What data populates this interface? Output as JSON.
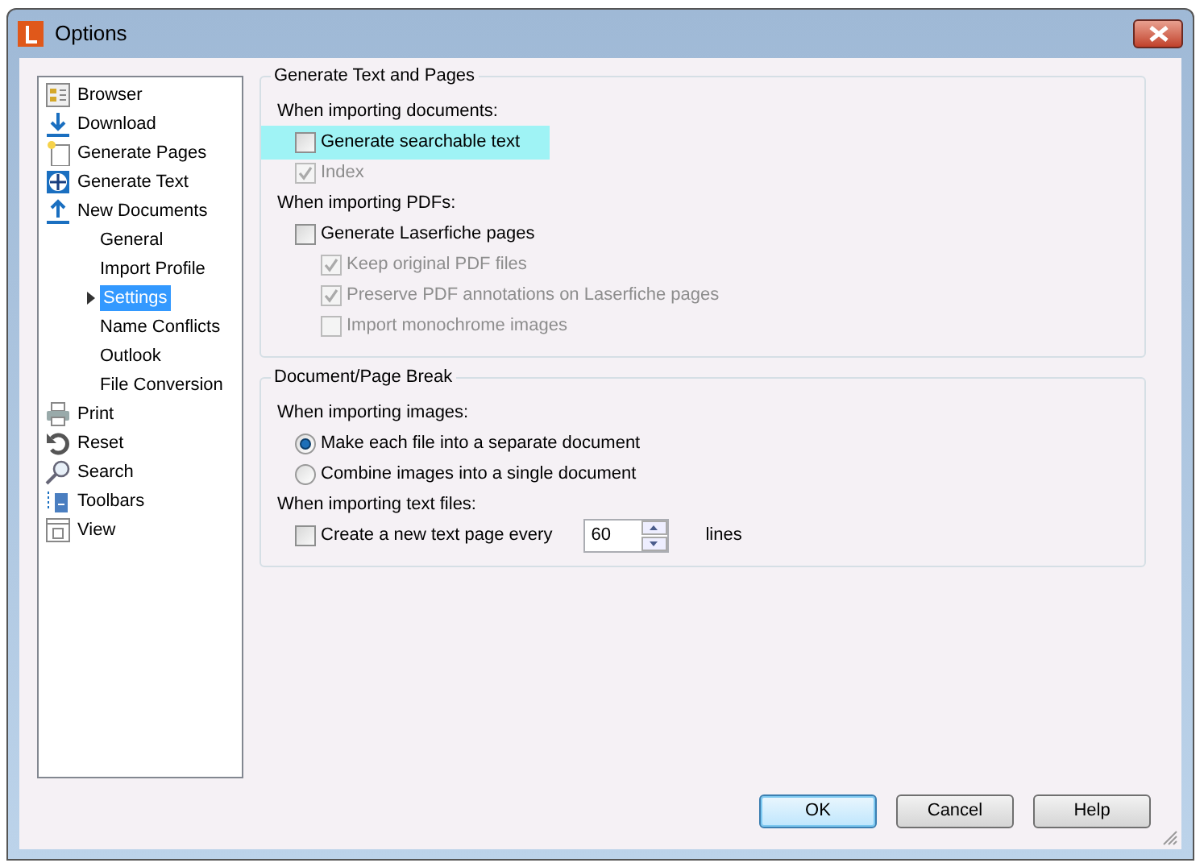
{
  "window": {
    "title": "Options"
  },
  "sidebar": {
    "items": [
      {
        "label": "Browser",
        "kind": "browser",
        "selected": false
      },
      {
        "label": "Download",
        "kind": "download",
        "selected": false
      },
      {
        "label": "Generate Pages",
        "kind": "pages",
        "selected": false
      },
      {
        "label": "Generate Text",
        "kind": "text",
        "selected": false
      },
      {
        "label": "New Documents",
        "kind": "upload",
        "selected": false,
        "children": [
          {
            "label": "General",
            "selected": false
          },
          {
            "label": "Import Profile",
            "selected": false
          },
          {
            "label": "Settings",
            "selected": true,
            "expanded": false
          },
          {
            "label": "Name Conflicts",
            "selected": false
          },
          {
            "label": "Outlook",
            "selected": false
          },
          {
            "label": "File Conversion",
            "selected": false
          }
        ]
      },
      {
        "label": "Print",
        "kind": "print",
        "selected": false
      },
      {
        "label": "Reset",
        "kind": "reset",
        "selected": false
      },
      {
        "label": "Search",
        "kind": "search",
        "selected": false
      },
      {
        "label": "Toolbars",
        "kind": "toolbars",
        "selected": false
      },
      {
        "label": "View",
        "kind": "view",
        "selected": false
      }
    ]
  },
  "groups": [
    {
      "title": "Generate Text and Pages",
      "sections": [
        {
          "heading": "When importing documents:",
          "options": [
            {
              "kind": "checkbox",
              "label": "Generate searchable text",
              "checked": false,
              "disabled": false,
              "highlighted": true
            },
            {
              "kind": "checkbox",
              "label": "Index",
              "checked": true,
              "disabled": true,
              "highlighted": false
            }
          ]
        },
        {
          "heading": "When importing PDFs:",
          "options": [
            {
              "kind": "checkbox",
              "label": "Generate Laserfiche pages",
              "checked": false,
              "disabled": false,
              "highlighted": false,
              "children": [
                {
                  "kind": "checkbox",
                  "label": "Keep original PDF files",
                  "checked": true,
                  "disabled": true,
                  "highlighted": false
                },
                {
                  "kind": "checkbox",
                  "label": "Preserve PDF annotations on Laserfiche pages",
                  "checked": true,
                  "disabled": true,
                  "highlighted": false
                },
                {
                  "kind": "checkbox",
                  "label": "Import monochrome images",
                  "checked": false,
                  "disabled": true,
                  "highlighted": false
                }
              ]
            }
          ]
        }
      ]
    },
    {
      "title": "Document/Page Break",
      "sections": [
        {
          "heading": "When importing images:",
          "options": [
            {
              "kind": "radio",
              "label": "Make each file into a separate document",
              "selected": true
            },
            {
              "kind": "radio",
              "label": "Combine images into a single document",
              "selected": false
            }
          ]
        },
        {
          "heading": "When importing text files:",
          "options": [
            {
              "kind": "spin",
              "label": "Create a new text page every",
              "checked": false,
              "value": "60",
              "unit": "lines"
            }
          ]
        }
      ]
    }
  ],
  "buttons": [
    {
      "label": "OK",
      "default": true
    },
    {
      "label": "Cancel",
      "default": false
    },
    {
      "label": "Help",
      "default": false
    }
  ]
}
